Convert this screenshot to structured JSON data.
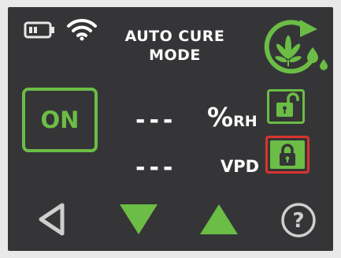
{
  "title": "AUTO CURE\nMODE",
  "power_button_label": "ON",
  "humidity": {
    "value": "---",
    "unit": "%",
    "unit_suffix": "RH",
    "lock_state": "unlocked"
  },
  "vpd": {
    "value": "---",
    "unit": "VPD",
    "lock_state": "locked"
  },
  "icons": {
    "battery": "battery-icon",
    "wifi": "wifi-icon",
    "mode": "cannabis-leaf-cycle-icon",
    "back": "back-triangle-icon",
    "down": "down-arrow-icon",
    "up": "up-arrow-icon",
    "help": "help-icon"
  },
  "colors": {
    "background": "#353537",
    "accent": "#6bbd45",
    "alert": "#d8342e",
    "text": "#ffffff",
    "icon": "#cfcfcf"
  }
}
